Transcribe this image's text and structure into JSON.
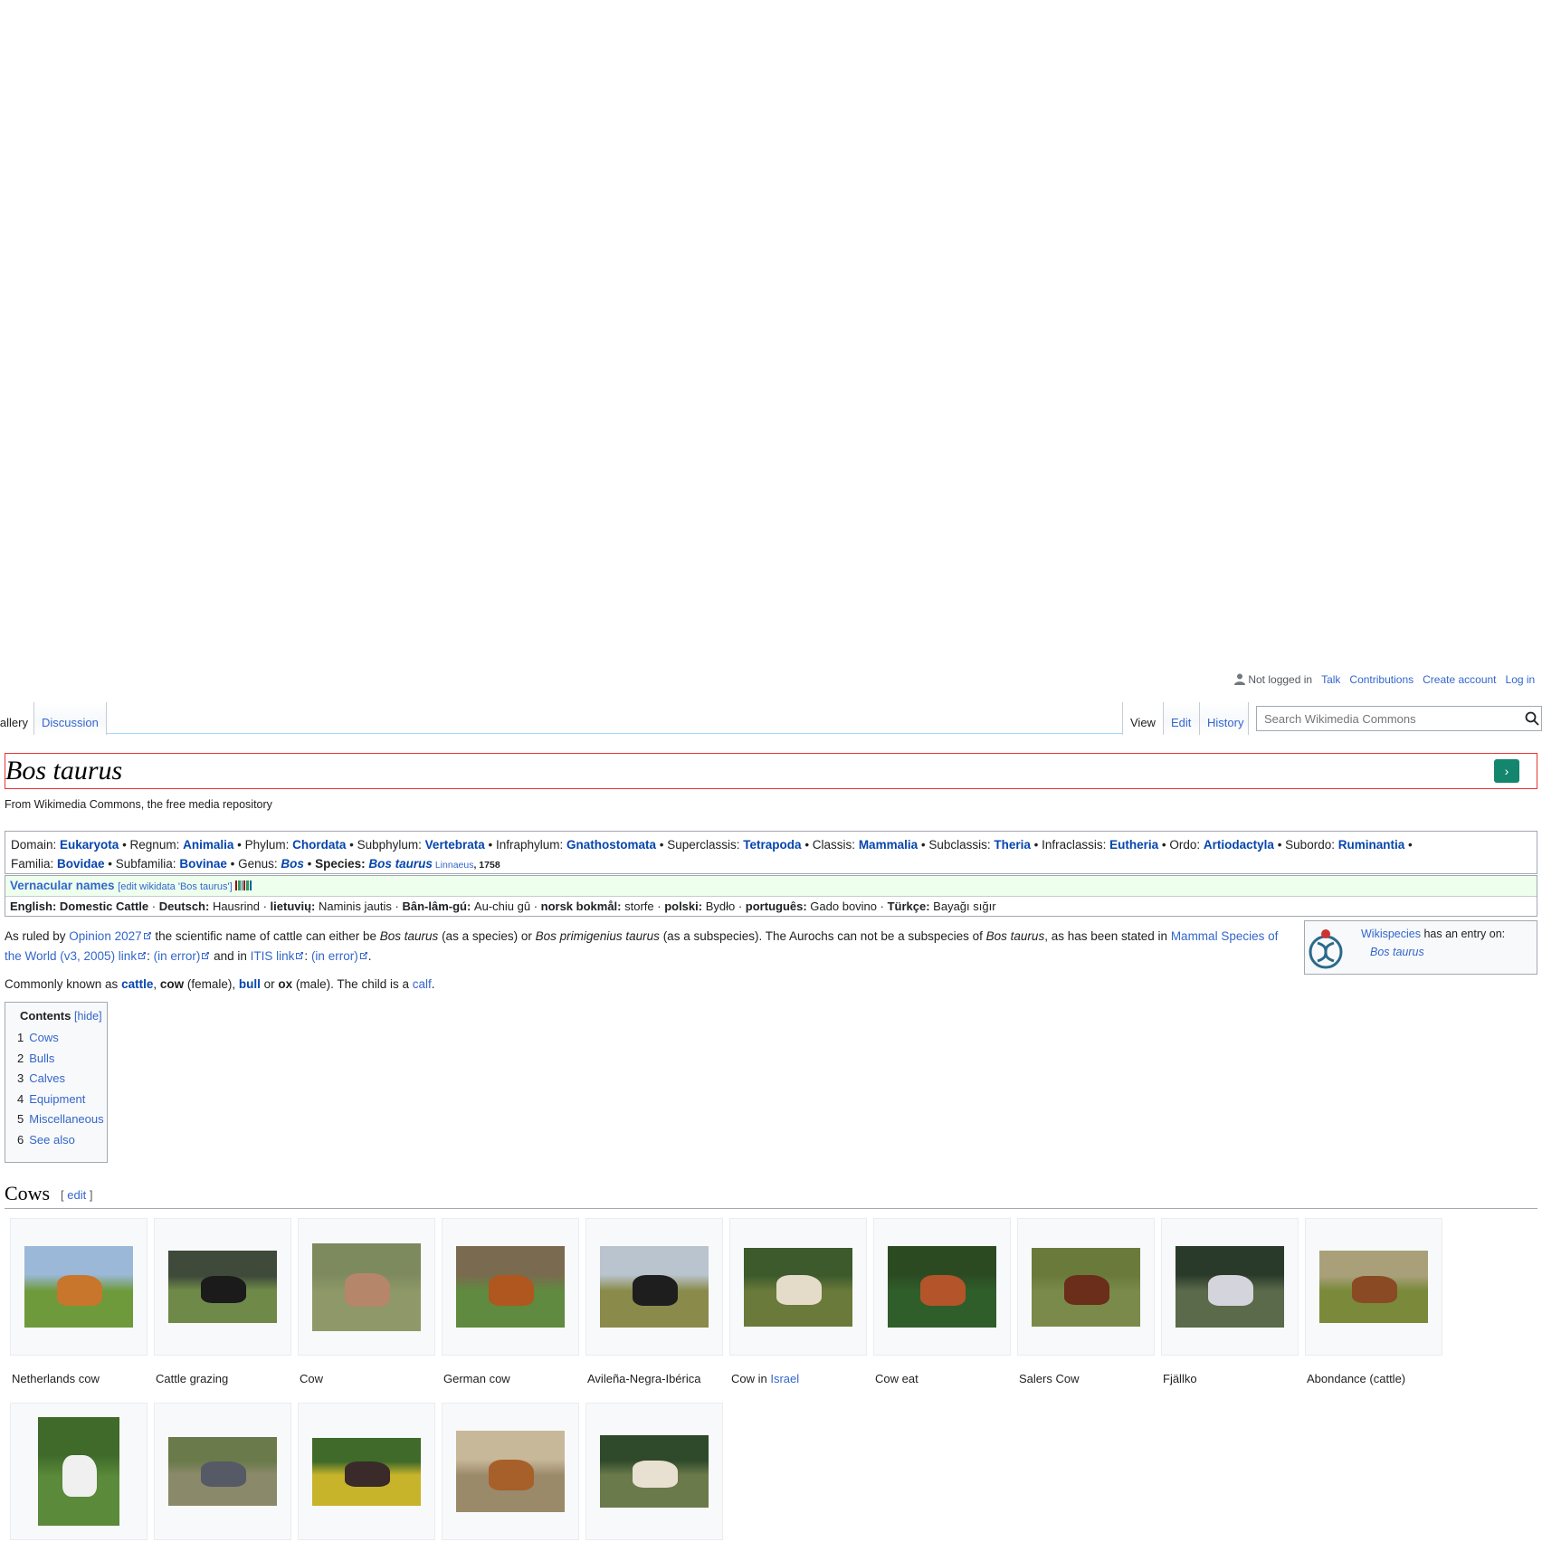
{
  "personal": {
    "not_logged_in": "Not logged in",
    "talk": "Talk",
    "contributions": "Contributions",
    "create_account": "Create account",
    "log_in": "Log in"
  },
  "tabs": {
    "gallery": "Gallery",
    "discussion": "Discussion",
    "view": "View",
    "edit": "Edit",
    "history": "History"
  },
  "search": {
    "placeholder": "Search Wikimedia Commons"
  },
  "page": {
    "title": "Bos taurus",
    "go_symbol": "›",
    "site_sub": "From Wikimedia Commons, the free media repository"
  },
  "taxonavigation": {
    "line1": [
      {
        "rank": "Domain",
        "name": "Eukaryota"
      },
      {
        "rank": "Regnum",
        "name": "Animalia"
      },
      {
        "rank": "Phylum",
        "name": "Chordata"
      },
      {
        "rank": "Subphylum",
        "name": "Vertebrata"
      },
      {
        "rank": "Infraphylum",
        "name": "Gnathostomata"
      },
      {
        "rank": "Superclassis",
        "name": "Tetrapoda"
      },
      {
        "rank": "Classis",
        "name": "Mammalia"
      },
      {
        "rank": "Subclassis",
        "name": "Theria"
      },
      {
        "rank": "Infraclassis",
        "name": "Eutheria"
      },
      {
        "rank": "Ordo",
        "name": "Artiodactyla"
      },
      {
        "rank": "Subordo",
        "name": "Ruminantia"
      }
    ],
    "line2": [
      {
        "rank": "Familia",
        "name": "Bovidae"
      },
      {
        "rank": "Subfamilia",
        "name": "Bovinae"
      },
      {
        "rank": "Genus",
        "name": "Bos"
      }
    ],
    "species_label": "Species",
    "species": "Bos taurus",
    "authority": "Linnaeus",
    "year": "1758"
  },
  "vernacular": {
    "title": "Vernacular names",
    "edit_link": "[edit wikidata 'Bos taurus']",
    "names": [
      {
        "lang": "English",
        "name": "Domestic Cattle",
        "bold": true
      },
      {
        "lang": "Deutsch",
        "name": "Hausrind"
      },
      {
        "lang": "lietuvių",
        "name": "Naminis jautis"
      },
      {
        "lang": "Bân-lâm-gú",
        "name": "Au-chiu gû"
      },
      {
        "lang": "norsk bokmål",
        "name": "storfe"
      },
      {
        "lang": "polski",
        "name": "Bydło"
      },
      {
        "lang": "português",
        "name": "Gado bovino"
      },
      {
        "lang": "Türkçe",
        "name": "Bayağı sığır"
      }
    ]
  },
  "intro": {
    "t1": "As ruled by ",
    "opinion": "Opinion 2027",
    "t2": " the scientific name of cattle can either be ",
    "bos_taurus": "Bos taurus",
    "t3": " (as a species) or ",
    "bos_prim": "Bos primigenius taurus",
    "t4": " (as a subspecies). The Aurochs can not be a subspecies of ",
    "bos_taurus2": "Bos taurus",
    "t5": ", as has been stated in ",
    "msw": "Mammal Species of the World (v3, 2005) link",
    "t6": ": ",
    "in_error": "(in error)",
    "t7": " and in ",
    "itis": "ITIS link",
    "t8": ": ",
    "in_error2": "(in error)",
    "t9": "."
  },
  "common": {
    "t1": "Commonly known as ",
    "cattle": "cattle",
    "t2": ", ",
    "cow": "cow",
    "t3": " (female), ",
    "bull": "bull",
    "t4": " or ",
    "ox": "ox",
    "t5": " (male). The child is a ",
    "calf": "calf",
    "t6": "."
  },
  "wikispecies": {
    "link": "Wikispecies",
    "text": " has an entry on:",
    "entry": "Bos taurus"
  },
  "toc": {
    "title": "Contents",
    "hide": "[hide]",
    "items": [
      {
        "num": "1",
        "label": "Cows"
      },
      {
        "num": "2",
        "label": "Bulls"
      },
      {
        "num": "3",
        "label": "Calves"
      },
      {
        "num": "4",
        "label": "Equipment"
      },
      {
        "num": "5",
        "label": "Miscellaneous"
      },
      {
        "num": "6",
        "label": "See also"
      }
    ]
  },
  "section_cows": {
    "title": "Cows",
    "edit": "edit",
    "bracket_open": "[",
    "bracket_close": "]"
  },
  "gallery": [
    {
      "caption": "Netherlands cow",
      "colors": [
        "#9bb8d9",
        "#6e9a3c",
        "#c8762c"
      ]
    },
    {
      "caption": "Cattle grazing",
      "colors": [
        "#3f4a3a",
        "#6f8a48",
        "#1b1b1b"
      ]
    },
    {
      "caption": "Cow",
      "colors": [
        "#7d8a5e",
        "#8e9868",
        "#b5866a"
      ]
    },
    {
      "caption": "German cow",
      "colors": [
        "#7a6a4f",
        "#5f8a3f",
        "#b0561f"
      ]
    },
    {
      "caption": "Avileña-Negra-Ibérica",
      "colors": [
        "#b9c4cf",
        "#8a8a4a",
        "#1e1e1e"
      ]
    },
    {
      "caption_pre": "Cow in ",
      "caption_link": "Israel",
      "colors": [
        "#3c5a2c",
        "#6a7a3a",
        "#e4dcc8"
      ]
    },
    {
      "caption": "Cow eat",
      "colors": [
        "#2c4a22",
        "#2f5e2a",
        "#b4542a"
      ]
    },
    {
      "caption": "Salers Cow",
      "colors": [
        "#6a7a3a",
        "#7a8a4a",
        "#6a2e1a"
      ]
    },
    {
      "caption": "Fjällko",
      "colors": [
        "#2a3a2a",
        "#5a6a4a",
        "#d4d4dc"
      ]
    },
    {
      "caption": "Abondance (cattle)",
      "colors": [
        "#a9a07a",
        "#7a8a3a",
        "#8a4a24"
      ]
    },
    {
      "caption": "",
      "colors": [
        "#3f6a2a",
        "#5a8a3a",
        "#f0f0f0"
      ]
    },
    {
      "caption": "",
      "colors": [
        "#6a7a4a",
        "#8a8a6a",
        "#555a66"
      ]
    },
    {
      "caption": "",
      "colors": [
        "#3f6a2a",
        "#c8b42a",
        "#3a2a2a"
      ]
    },
    {
      "caption": "",
      "colors": [
        "#c8b89a",
        "#9a8a6a",
        "#a8602a"
      ]
    },
    {
      "caption": "",
      "colors": [
        "#2f4a2a",
        "#6a7a4a",
        "#e8e0d0"
      ]
    }
  ]
}
